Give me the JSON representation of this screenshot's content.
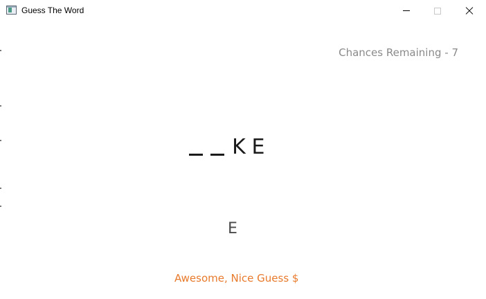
{
  "window": {
    "title": "Guess The Word",
    "icon": "window-app-icon",
    "controls": {
      "minimize": "minimize-icon",
      "maximize": "maximize-icon",
      "close": "close-icon"
    }
  },
  "game": {
    "chances_label": "Chances Remaining - 7",
    "word_slots": [
      "_",
      "_",
      "K",
      "E"
    ],
    "typed_letter": "E",
    "message": "Awesome, Nice Guess $"
  },
  "colors": {
    "chances_text": "#8a8a8a",
    "word_text": "#1a1a1a",
    "typed_letter_text": "#4a4a4a",
    "message_text": "#e87a2c"
  }
}
